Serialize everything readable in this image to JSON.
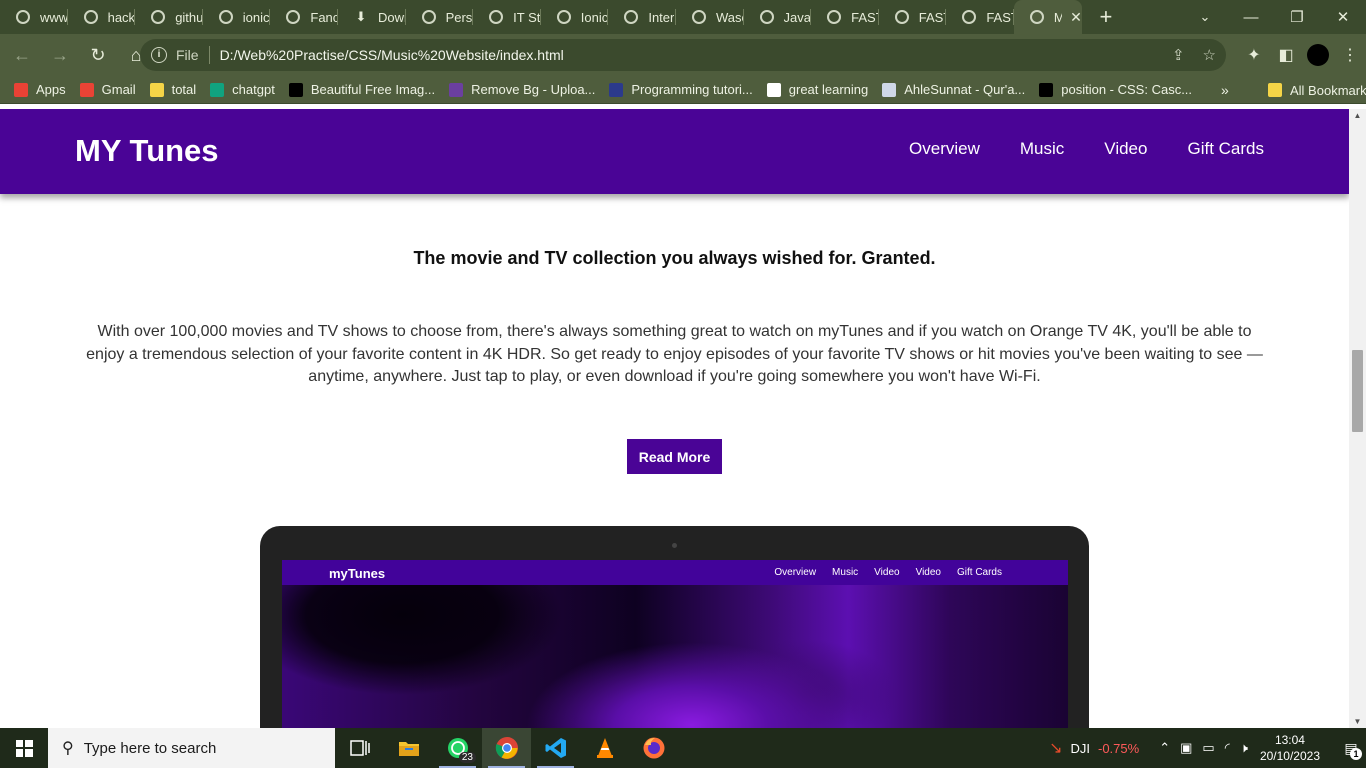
{
  "browser": {
    "tabs": [
      {
        "label": "www.",
        "icon": "globe-icon"
      },
      {
        "label": "hack",
        "icon": "globe-icon"
      },
      {
        "label": "githu",
        "icon": "globe-icon"
      },
      {
        "label": "ionic.",
        "icon": "globe-icon"
      },
      {
        "label": "Fancy",
        "icon": "globe-icon"
      },
      {
        "label": "Dowr",
        "icon": "download-icon"
      },
      {
        "label": "Perso",
        "icon": "globe-icon"
      },
      {
        "label": "IT Stu",
        "icon": "globe-icon"
      },
      {
        "label": "Ionic",
        "icon": "globe-icon"
      },
      {
        "label": "Inter",
        "icon": "globe-icon"
      },
      {
        "label": "Wase",
        "icon": "globe-icon"
      },
      {
        "label": "JavaS",
        "icon": "globe-icon"
      },
      {
        "label": "FAST",
        "icon": "globe-icon"
      },
      {
        "label": "FAST",
        "icon": "globe-icon"
      },
      {
        "label": "FAST",
        "icon": "globe-icon"
      },
      {
        "label": "M",
        "icon": "globe-icon",
        "active": true
      }
    ],
    "address": {
      "scheme_label": "File",
      "url": "D:/Web%20Practise/CSS/Music%20Website/index.html"
    },
    "bookmarks": [
      {
        "label": "Apps",
        "icon": "apps-grid-icon",
        "color": "#e94235"
      },
      {
        "label": "Gmail",
        "icon": "gmail-icon",
        "color": "#ea4335"
      },
      {
        "label": "total",
        "icon": "folder-icon",
        "color": "#f5d547"
      },
      {
        "label": "chatgpt",
        "icon": "chatgpt-icon",
        "color": "#10a37f"
      },
      {
        "label": "Beautiful Free Imag...",
        "icon": "unsplash-icon",
        "color": "#000000"
      },
      {
        "label": "Remove Bg - Uploa...",
        "icon": "removebg-icon",
        "color": "#6b3fa0"
      },
      {
        "label": "Programming tutori...",
        "icon": "h-icon",
        "color": "#2b3a8c"
      },
      {
        "label": "great learning",
        "icon": "google-icon",
        "color": "#ffffff"
      },
      {
        "label": "AhleSunnat - Qur'a...",
        "icon": "avatar-icon",
        "color": "#cfd8e8"
      },
      {
        "label": "position - CSS: Casc...",
        "icon": "mdn-icon",
        "color": "#000000"
      }
    ],
    "bookmarks_more": "»",
    "all_bookmarks": "All Bookmarks"
  },
  "site": {
    "logo": "MY Tunes",
    "nav": [
      "Overview",
      "Music",
      "Video",
      "Gift Cards"
    ],
    "headline": "The movie and TV collection you always wished for. Granted.",
    "paragraph": "With over 100,000 movies and TV shows to choose from, there's always something great to watch on myTunes and if you watch on Orange TV 4K, you'll be able to enjoy a tremendous selection of your favorite content in 4K HDR. So get ready to enjoy episodes of your favorite TV shows or hit movies you've been waiting to see — anytime, anywhere. Just tap to play, or even download if you're going somewhere you won't have Wi-Fi.",
    "read_more": "Read More",
    "accent_color": "#4a0496",
    "mockup": {
      "logo": "myTunes",
      "nav": [
        "Overview",
        "Music",
        "Video",
        "Video",
        "Gift Cards"
      ]
    }
  },
  "taskbar": {
    "search_placeholder": "Type here to search",
    "whatsapp_badge": "23",
    "stock_name": "DJI",
    "stock_change": "-0.75%",
    "time": "13:04",
    "date": "20/10/2023",
    "notification_count": "1"
  }
}
